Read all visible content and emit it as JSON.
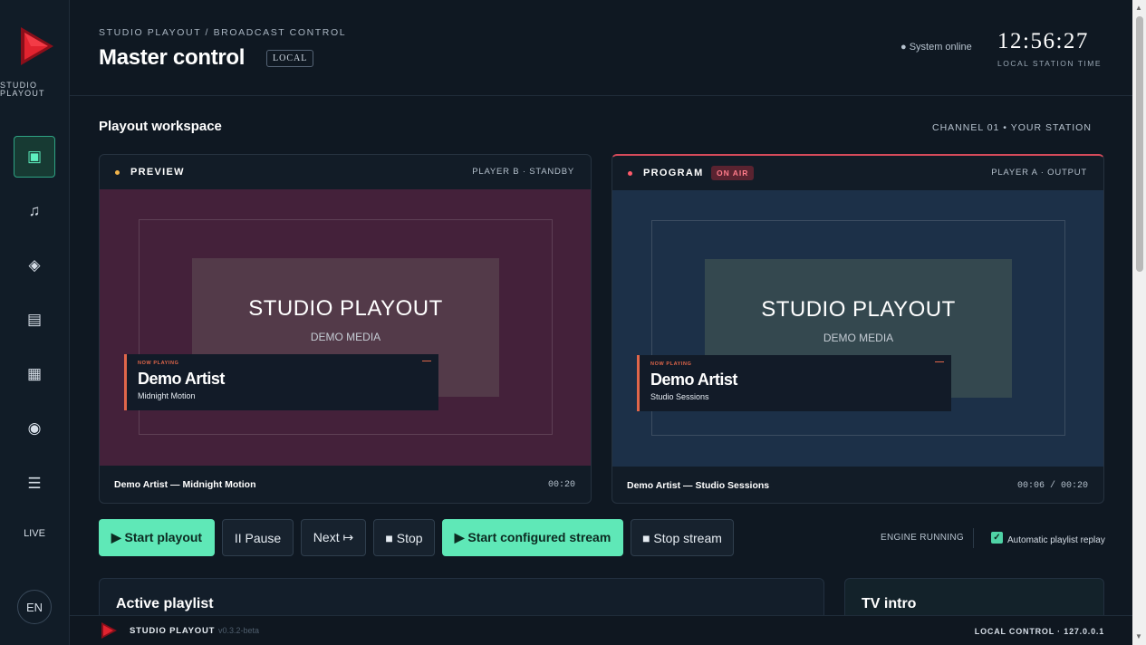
{
  "app": {
    "brand": "STUDIO PLAYOUT"
  },
  "sidebar": {
    "items": [
      {
        "name": "dashboard",
        "icon": "▣"
      },
      {
        "name": "music",
        "icon": "♫"
      },
      {
        "name": "graphics",
        "icon": "◈"
      },
      {
        "name": "playlists",
        "icon": "▤"
      },
      {
        "name": "schedule",
        "icon": "▦"
      },
      {
        "name": "record",
        "icon": "◉"
      },
      {
        "name": "menu",
        "icon": "☰"
      }
    ],
    "live_label": "LIVE",
    "language": "EN"
  },
  "header": {
    "breadcrumb": "STUDIO PLAYOUT / BROADCAST CONTROL",
    "title": "Master control",
    "badge": "LOCAL",
    "system_status": "● System online",
    "clock": "12:56:27",
    "clock_label": "LOCAL STATION TIME"
  },
  "workspace": {
    "title": "Playout workspace",
    "channel": "CHANNEL 01   •   YOUR STATION"
  },
  "preview": {
    "label": "PREVIEW",
    "player": "PLAYER B · STANDBY",
    "slate_title": "STUDIO PLAYOUT",
    "slate_subtitle": "DEMO MEDIA",
    "now_playing": "NOW PLAYING",
    "artist": "Demo Artist",
    "track": "Midnight Motion",
    "footer_title": "Demo Artist — Midnight Motion",
    "time": "00:20",
    "dot_color": "#f0b34a"
  },
  "program": {
    "label": "PROGRAM",
    "on_air": "ON AIR",
    "player": "PLAYER A · OUTPUT",
    "slate_title": "STUDIO PLAYOUT",
    "slate_subtitle": "DEMO MEDIA",
    "now_playing": "NOW PLAYING",
    "artist": "Demo Artist",
    "track": "Studio Sessions",
    "footer_title": "Demo Artist — Studio Sessions",
    "time": "00:06 / 00:20",
    "dot_color": "#ff5a6a"
  },
  "controls": {
    "start_playout": "▶ Start playout",
    "pause": "II Pause",
    "next": "Next ↦",
    "stop": "■ Stop",
    "start_stream": "▶ Start configured stream",
    "stop_stream": "■ Stop stream",
    "engine_status": "ENGINE RUNNING",
    "auto_replay_label": "Automatic playlist replay",
    "auto_replay_checked": true
  },
  "cards": {
    "playlist_title": "Active playlist",
    "intro_title": "TV intro"
  },
  "footer": {
    "brand": "STUDIO PLAYOUT",
    "version": "v0.3.2-beta",
    "right": "LOCAL CONTROL · 127.0.0.1"
  },
  "colors": {
    "accent": "#5fe8b7",
    "on_air": "#d44a5a",
    "logo_red": "#d8202e"
  }
}
